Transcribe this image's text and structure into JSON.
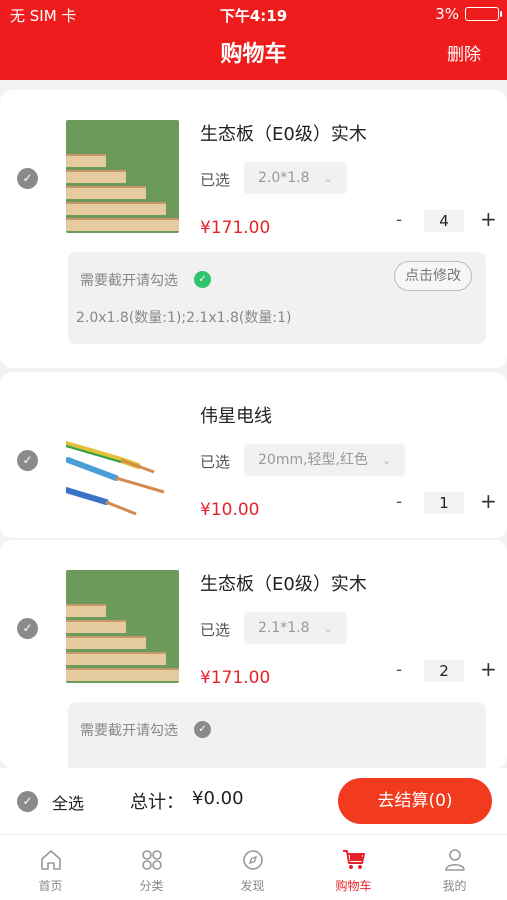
{
  "status_bar": {
    "carrier": "无 SIM 卡",
    "time": "下午4:19",
    "battery": "3%"
  },
  "header": {
    "title": "购物车",
    "delete_label": "删除"
  },
  "cart": {
    "items": [
      {
        "name": "生态板（E0级）实木",
        "selected_label": "已选",
        "spec": "2.0*1.8",
        "price": "¥171.00",
        "minus": "-",
        "quantity": "4",
        "plus": "+",
        "cut_prompt": "需要截开请勾选",
        "modify_label": "点击修改",
        "cut_detail": "2.0x1.8(数量:1);2.1x1.8(数量:1)"
      },
      {
        "name": "伟星电线",
        "selected_label": "已选",
        "spec": "20mm,轻型,红色",
        "price": "¥10.00",
        "minus": "-",
        "quantity": "1",
        "plus": "+"
      },
      {
        "name": "生态板（E0级）实木",
        "selected_label": "已选",
        "spec": "2.1*1.8",
        "price": "¥171.00",
        "minus": "-",
        "quantity": "2",
        "plus": "+",
        "cut_prompt": "需要截开请勾选"
      }
    ]
  },
  "bottom_bar": {
    "select_all": "全选",
    "total_label": "总计：",
    "total_value": "¥0.00",
    "checkout_label": "去结算(0)"
  },
  "tabs": [
    {
      "label": "首页",
      "icon": "home-icon"
    },
    {
      "label": "分类",
      "icon": "category-icon"
    },
    {
      "label": "发现",
      "icon": "compass-icon"
    },
    {
      "label": "购物车",
      "icon": "cart-icon",
      "active": true
    },
    {
      "label": "我的",
      "icon": "user-icon"
    }
  ],
  "colors": {
    "brand": "#ee1c1c",
    "price": "#e5242a",
    "checkout": "#f23a1f",
    "checked_green": "#2ec46b"
  }
}
